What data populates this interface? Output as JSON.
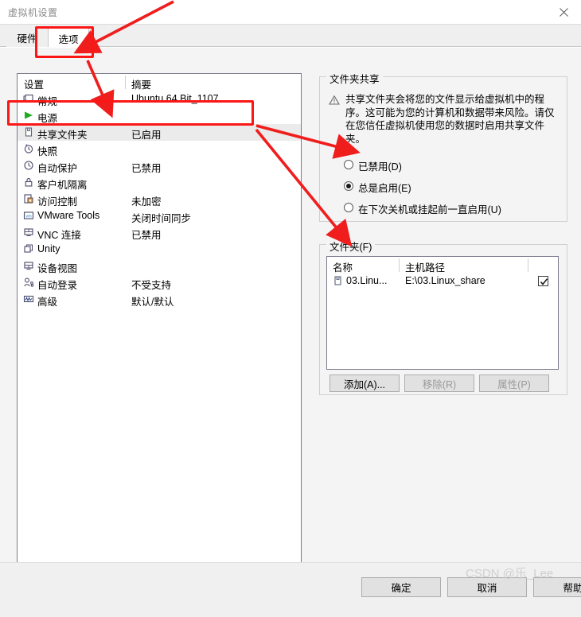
{
  "window": {
    "title": "虚拟机设置",
    "close_icon": "close-icon"
  },
  "tabs": [
    {
      "label": "硬件",
      "selected": false
    },
    {
      "label": "选项",
      "selected": true
    }
  ],
  "left_panel": {
    "headers": {
      "setting": "设置",
      "summary": "摘要"
    },
    "rows": [
      {
        "icon": "monitor-icon",
        "label": "常规",
        "summary": "Ubuntu 64 Bit_1107",
        "selected": false
      },
      {
        "icon": "power-play-icon",
        "label": "电源",
        "summary": "",
        "selected": false
      },
      {
        "icon": "shared-folder-icon",
        "label": "共享文件夹",
        "summary": "已启用",
        "selected": true
      },
      {
        "icon": "snapshot-clock-icon",
        "label": "快照",
        "summary": "",
        "selected": false
      },
      {
        "icon": "autoprotect-clock-icon",
        "label": "自动保护",
        "summary": "已禁用",
        "selected": false
      },
      {
        "icon": "lock-icon",
        "label": "客户机隔离",
        "summary": "",
        "selected": false
      },
      {
        "icon": "access-control-lock-icon",
        "label": "访问控制",
        "summary": "未加密",
        "selected": false
      },
      {
        "icon": "vmware-tools-icon",
        "label": "VMware Tools",
        "summary": "关闭时间同步",
        "selected": false
      },
      {
        "icon": "vnc-icon",
        "label": "VNC 连接",
        "summary": "已禁用",
        "selected": false
      },
      {
        "icon": "unity-windows-icon",
        "label": "Unity",
        "summary": "",
        "selected": false
      },
      {
        "icon": "device-view-icon",
        "label": "设备视图",
        "summary": "",
        "selected": false
      },
      {
        "icon": "auto-login-icon",
        "label": "自动登录",
        "summary": "不受支持",
        "selected": false
      },
      {
        "icon": "advanced-graph-icon",
        "label": "高级",
        "summary": "默认/默认",
        "selected": false
      }
    ]
  },
  "sharing_group": {
    "title": "文件夹共享",
    "warning_icon": "warning-triangle-icon",
    "warning_text": "共享文件夹会将您的文件显示给虚拟机中的程序。这可能为您的计算机和数据带来风险。请仅在您信任虚拟机使用您的数据时启用共享文件夹。",
    "options": [
      {
        "label": "已禁用(D)",
        "selected": false
      },
      {
        "label": "总是启用(E)",
        "selected": true
      },
      {
        "label": "在下次关机或挂起前一直启用(U)",
        "selected": false
      }
    ]
  },
  "folders_group": {
    "title": "文件夹(F)",
    "columns": {
      "name": "名称",
      "path": "主机路径",
      "enabled": ""
    },
    "rows": [
      {
        "icon": "shared-folder-icon",
        "name": "03.Linu...",
        "path": "E:\\03.Linux_share",
        "enabled": true
      }
    ],
    "buttons": [
      {
        "label": "添加(A)...",
        "enabled": true
      },
      {
        "label": "移除(R)",
        "enabled": false
      },
      {
        "label": "属性(P)",
        "enabled": false
      }
    ]
  },
  "footer": {
    "ok": "确定",
    "cancel": "取消",
    "help": "帮助"
  },
  "watermark": {
    "text": "CSDN @乐_Lee"
  },
  "annotation": {
    "color": "#fc1616"
  }
}
